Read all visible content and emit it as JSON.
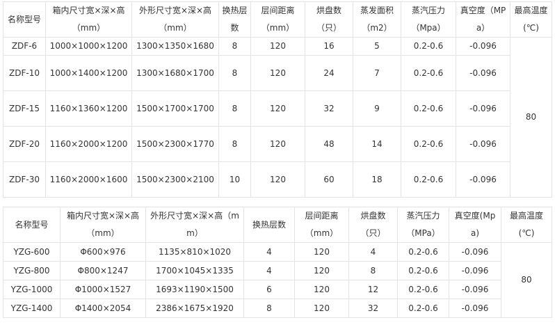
{
  "table1": {
    "headers": [
      "名称型号",
      "箱内尺寸宽×深×高（mm）",
      "外形尺寸宽×深×高（mm）",
      "换热层数",
      "层间距离（mm）",
      "烘盘数（只）",
      "蒸发面积（m2）",
      "蒸汽压力（Mpa）",
      "真空度（MPa）",
      "最高温度(℃)"
    ],
    "rows": [
      [
        "ZDF-6",
        "1000×1000×1200",
        "1300×1350×1680",
        "8",
        "120",
        "16",
        "5",
        "0.2-0.6",
        "-0.096"
      ],
      [
        "ZDF-10",
        "1000×1400×1200",
        "1300×1680×1700",
        "8",
        "120",
        "24",
        "7",
        "0.2-0.6",
        "-0.096"
      ],
      [
        "ZDF-15",
        "1160×1360×1200",
        "1500×1700×1700",
        "8",
        "120",
        "32",
        "9",
        "0.2-0.6",
        "-0.096"
      ],
      [
        "ZDF-20",
        "1160×2000×1200",
        "1500×2300×1770",
        "8",
        "120",
        "48",
        "14",
        "0.2-0.6",
        "-0.096"
      ],
      [
        "ZDF-30",
        "1160×2000×1600",
        "1500×2300×2100",
        "10",
        "120",
        "60",
        "18",
        "0.2-0.6",
        "-0.096"
      ]
    ],
    "max_temp": "80"
  },
  "table2": {
    "headers": [
      "名称型号",
      "箱内尺寸宽×深×高（mm）",
      "外形尺寸宽×深×高（mm）",
      "换热层数",
      "层间距离（mm）",
      "烘盘数（只）",
      "蒸汽压力（MPa）",
      "真空度(Mpa)",
      "最高温度(℃)"
    ],
    "rows": [
      [
        "YZG-600",
        "Φ600×976",
        "1135×810×1020",
        "4",
        "120",
        "4",
        "0.2-0.6",
        "-0.096"
      ],
      [
        "YZG-800",
        "Φ800×1247",
        "1700×1045×1335",
        "4",
        "120",
        "8",
        "0.2-0.6",
        "-0.096"
      ],
      [
        "YZG-1000",
        "Φ1000×1527",
        "1693×1190×1500",
        "6",
        "120",
        "12",
        "0.2-0.6",
        "-0.096"
      ],
      [
        "YZG-1400",
        "Φ1400×2054",
        "2386×1675×1920",
        "8",
        "120",
        "32",
        "0.2-0.6",
        "-0.096"
      ]
    ],
    "max_temp": "80"
  }
}
